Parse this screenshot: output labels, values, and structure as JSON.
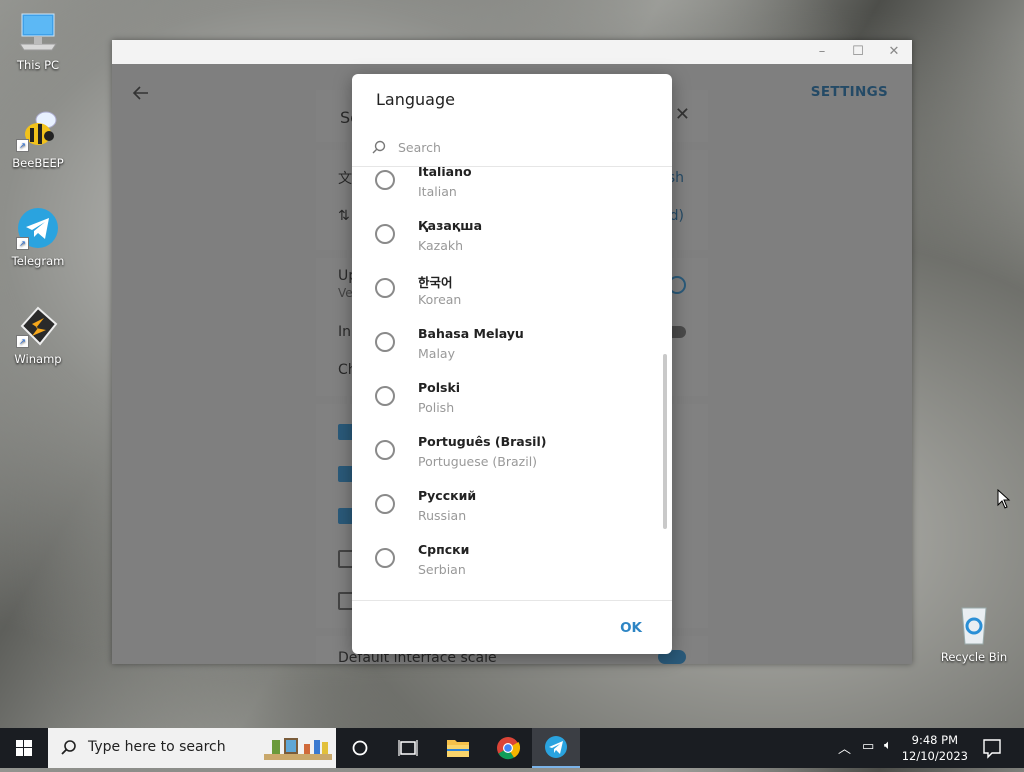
{
  "desktop": {
    "icons": [
      {
        "label": "This PC"
      },
      {
        "label": "BeeBEEP"
      },
      {
        "label": "Telegram"
      },
      {
        "label": "Winamp"
      },
      {
        "label": "Recycle Bin"
      }
    ]
  },
  "window": {
    "header_label": "SETTINGS",
    "bg_panel": {
      "title_partial": "Se",
      "row1_link_partial": "sh",
      "row2_link_partial": "d)",
      "row3_partial": "Up",
      "row3_sub_partial": "Ve",
      "row4_partial": "In",
      "row5_partial": "Ch",
      "scale_label": "Default interface scale"
    }
  },
  "dialog": {
    "title": "Language",
    "search_placeholder": "Search",
    "languages": [
      {
        "name": "Italiano",
        "english": "Italian"
      },
      {
        "name": "Қазақша",
        "english": "Kazakh"
      },
      {
        "name": "한국어",
        "english": "Korean"
      },
      {
        "name": "Bahasa Melayu",
        "english": "Malay"
      },
      {
        "name": "Polski",
        "english": "Polish"
      },
      {
        "name": "Português (Brasil)",
        "english": "Portuguese (Brazil)"
      },
      {
        "name": "Русский",
        "english": "Russian"
      },
      {
        "name": "Српски",
        "english": "Serbian"
      }
    ],
    "ok_label": "OK"
  },
  "taskbar": {
    "search_placeholder": "Type here to search",
    "time": "9:48 PM",
    "date": "12/10/2023"
  },
  "colors": {
    "accent": "#2d85c4",
    "taskbar": "#1a1d22",
    "dim_overlay": "#7f7f7f"
  }
}
